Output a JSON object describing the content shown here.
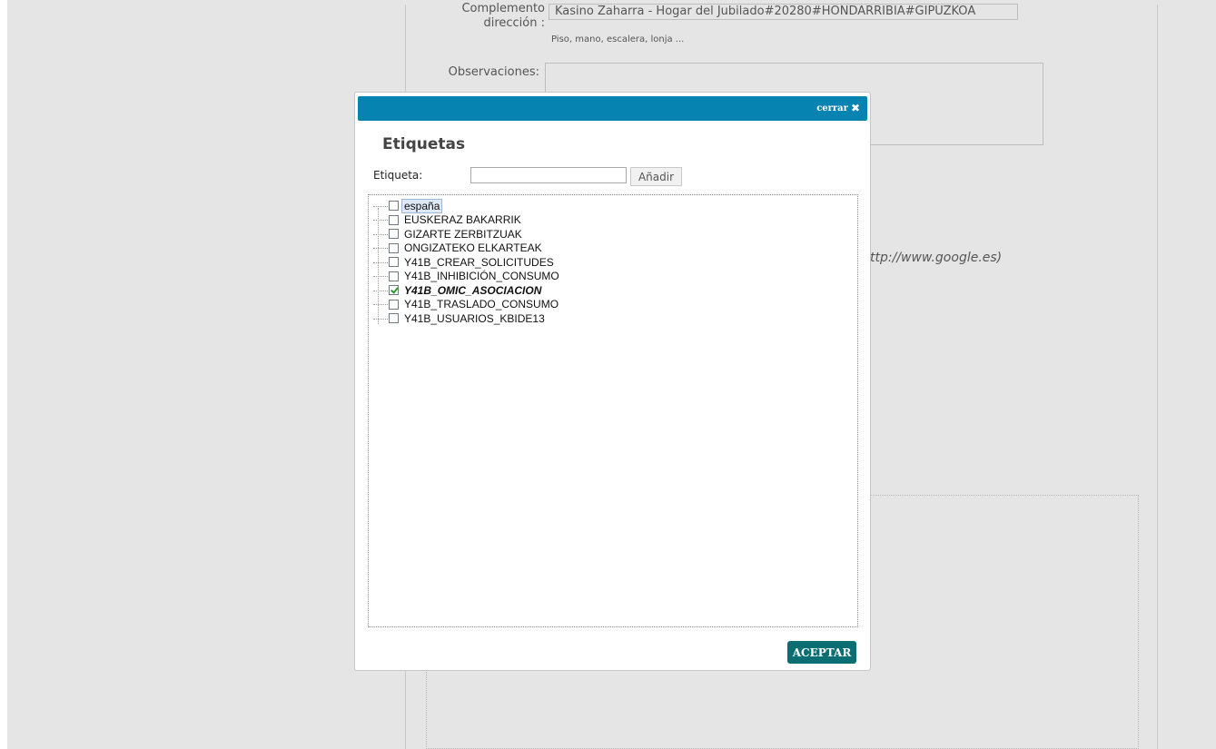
{
  "background": {
    "complemento_label": "Complemento dirección :",
    "complemento_value": "Kasino Zaharra - Hogar del Jubilado#20280#HONDARRIBIA#GIPUZKOA",
    "complemento_hint": "Piso, mano, escalera, lonja ...",
    "observaciones_label": "Observaciones:",
    "url_hint": "ttp://www.google.es)"
  },
  "modal": {
    "close_label": "cerrar",
    "close_icon": "close-icon",
    "title": "Etiquetas",
    "tag_label": "Etiqueta:",
    "tag_input_value": "",
    "add_button": "Añadir",
    "accept_button": "ACEPTAR",
    "header_color": "#0783b1",
    "accept_color": "#0b6e73",
    "tags": [
      {
        "label": "españa",
        "checked": false,
        "selected": true
      },
      {
        "label": "EUSKERAZ BAKARRIK",
        "checked": false
      },
      {
        "label": "GIZARTE ZERBITZUAK",
        "checked": false
      },
      {
        "label": "ONGIZATEKO ELKARTEAK",
        "checked": false
      },
      {
        "label": "Y41B_CREAR_SOLICITUDES",
        "checked": false
      },
      {
        "label": "Y41B_INHIBICIÓN_CONSUMO",
        "checked": false
      },
      {
        "label": "Y41B_OMIC_ASOCIACION",
        "checked": true
      },
      {
        "label": "Y41B_TRASLADO_CONSUMO",
        "checked": false
      },
      {
        "label": "Y41B_USUARIOS_KBIDE13",
        "checked": false
      }
    ]
  }
}
